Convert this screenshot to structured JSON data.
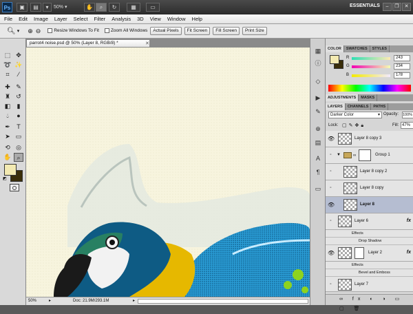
{
  "appbar": {
    "logo": "Ps",
    "zoom": "50%",
    "workspace": "ESSENTIALS"
  },
  "menu": [
    "File",
    "Edit",
    "Image",
    "Layer",
    "Select",
    "Filter",
    "Analysis",
    "3D",
    "View",
    "Window",
    "Help"
  ],
  "options": {
    "resize_label": "Resize Windows To Fit",
    "zoom_all_label": "Zoom All Windows",
    "buttons": [
      "Actual Pixels",
      "Fit Screen",
      "Fill Screen",
      "Print Size"
    ]
  },
  "document": {
    "tab_title": "parrot4 noise.psd @ 50% (Layer 8, RGB/8) *",
    "zoom": "50%",
    "doc_info": "Doc: 21.9M/293.1M"
  },
  "color_panel": {
    "tabs": [
      "COLOR",
      "SWATCHES",
      "STYLES"
    ],
    "r_label": "R",
    "g_label": "G",
    "b_label": "B",
    "r": "243",
    "g": "234",
    "b": "178",
    "fg_color": "#f3eab2",
    "bg_color": "#3a2e0a"
  },
  "adjustments_panel": {
    "tabs": [
      "ADJUSTMENTS",
      "MASKS"
    ]
  },
  "layers_panel": {
    "tabs": [
      "LAYERS",
      "CHANNELS",
      "PATHS"
    ],
    "blend_mode": "Darker Color",
    "opacity_label": "Opacity:",
    "opacity": "100%",
    "lock_label": "Lock:",
    "fill_label": "Fill:",
    "fill": "47%",
    "layers": [
      {
        "name": "Layer 8 copy 3",
        "visible": true
      },
      {
        "name": "Group 1",
        "visible": false
      },
      {
        "name": "Layer 8 copy 2",
        "visible": false
      },
      {
        "name": "Layer 8 copy",
        "visible": false
      },
      {
        "name": "Layer 8",
        "visible": true
      },
      {
        "name": "Layer 6",
        "visible": false
      },
      {
        "name": "Layer 2",
        "visible": true
      },
      {
        "name": "Layer 7",
        "visible": false
      }
    ],
    "effects_label": "Effects",
    "drop_shadow": "Drop Shadow",
    "bevel_emboss": "Bevel and Emboss",
    "fx": "fx"
  }
}
